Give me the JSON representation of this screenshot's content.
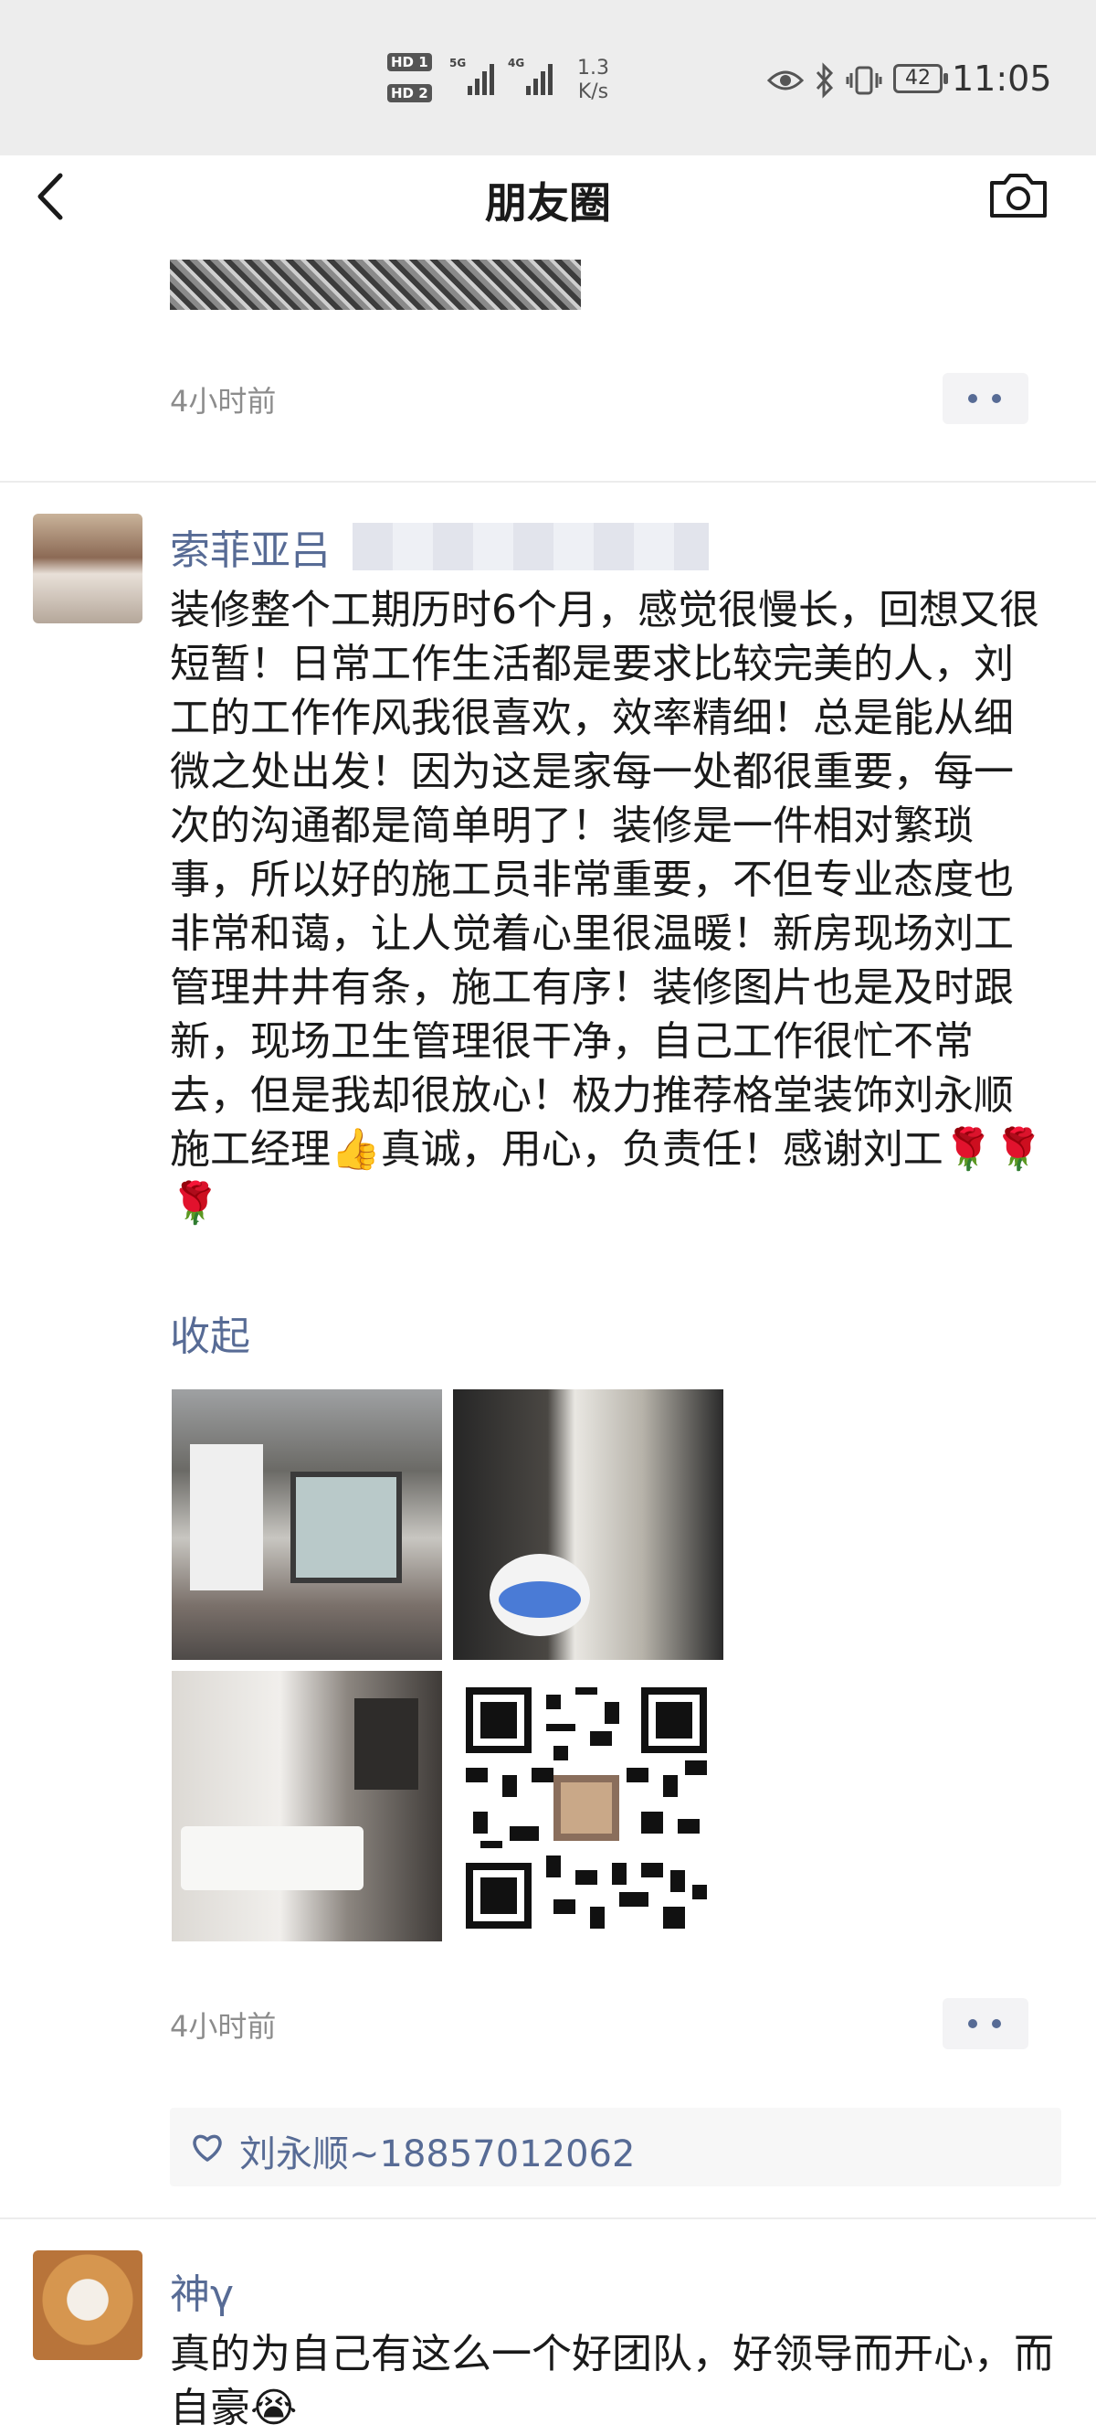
{
  "status_bar": {
    "hd1": "HD 1",
    "hd2": "HD 2",
    "sig1_tag": "5G",
    "sig2_tag": "4G",
    "speed_value": "1.3",
    "speed_unit": "K/s",
    "battery": "42",
    "time": "11:05"
  },
  "nav": {
    "title": "朋友圈",
    "back_icon": "chevron-left-icon",
    "camera_icon": "camera-icon"
  },
  "feed": {
    "prev_post": {
      "timestamp": "4小时前"
    },
    "post": {
      "author": "索菲亚吕",
      "text": "装修整个工期历时6个月，感觉很慢长，回想又很短暂！日常工作生活都是要求比较完美的人，刘工的工作作风我很喜欢，效率精细！总是能从细微之处出发！因为这是家每一处都很重要，每一次的沟通都是简单明了！装修是一件相对繁琐事，所以好的施工员非常重要，不但专业态度也非常和蔼，让人觉着心里很温暖！新房现场刘工管理井井有条，施工有序！装修图片也是及时跟新，现场卫生管理很干净，自己工作很忙不常去，但是我却很放心！极力推荐格堂装饰刘永顺施工经理👍真诚，用心，负责任！感谢刘工🌹🌹🌹",
      "collapse_label": "收起",
      "photos": [
        "living-room-photo",
        "shower-room-photo",
        "bathroom-photo",
        "qr-code"
      ],
      "timestamp": "4小时前",
      "likes": "刘永顺~18857012062"
    },
    "next_post": {
      "author": "神γ",
      "text": "真的为自己有这么一个好团队，好领导而开心，而自豪😭"
    }
  },
  "colors": {
    "link": "#576b95",
    "timestamp": "#8c8c8c",
    "header_bg": "#ededed"
  }
}
